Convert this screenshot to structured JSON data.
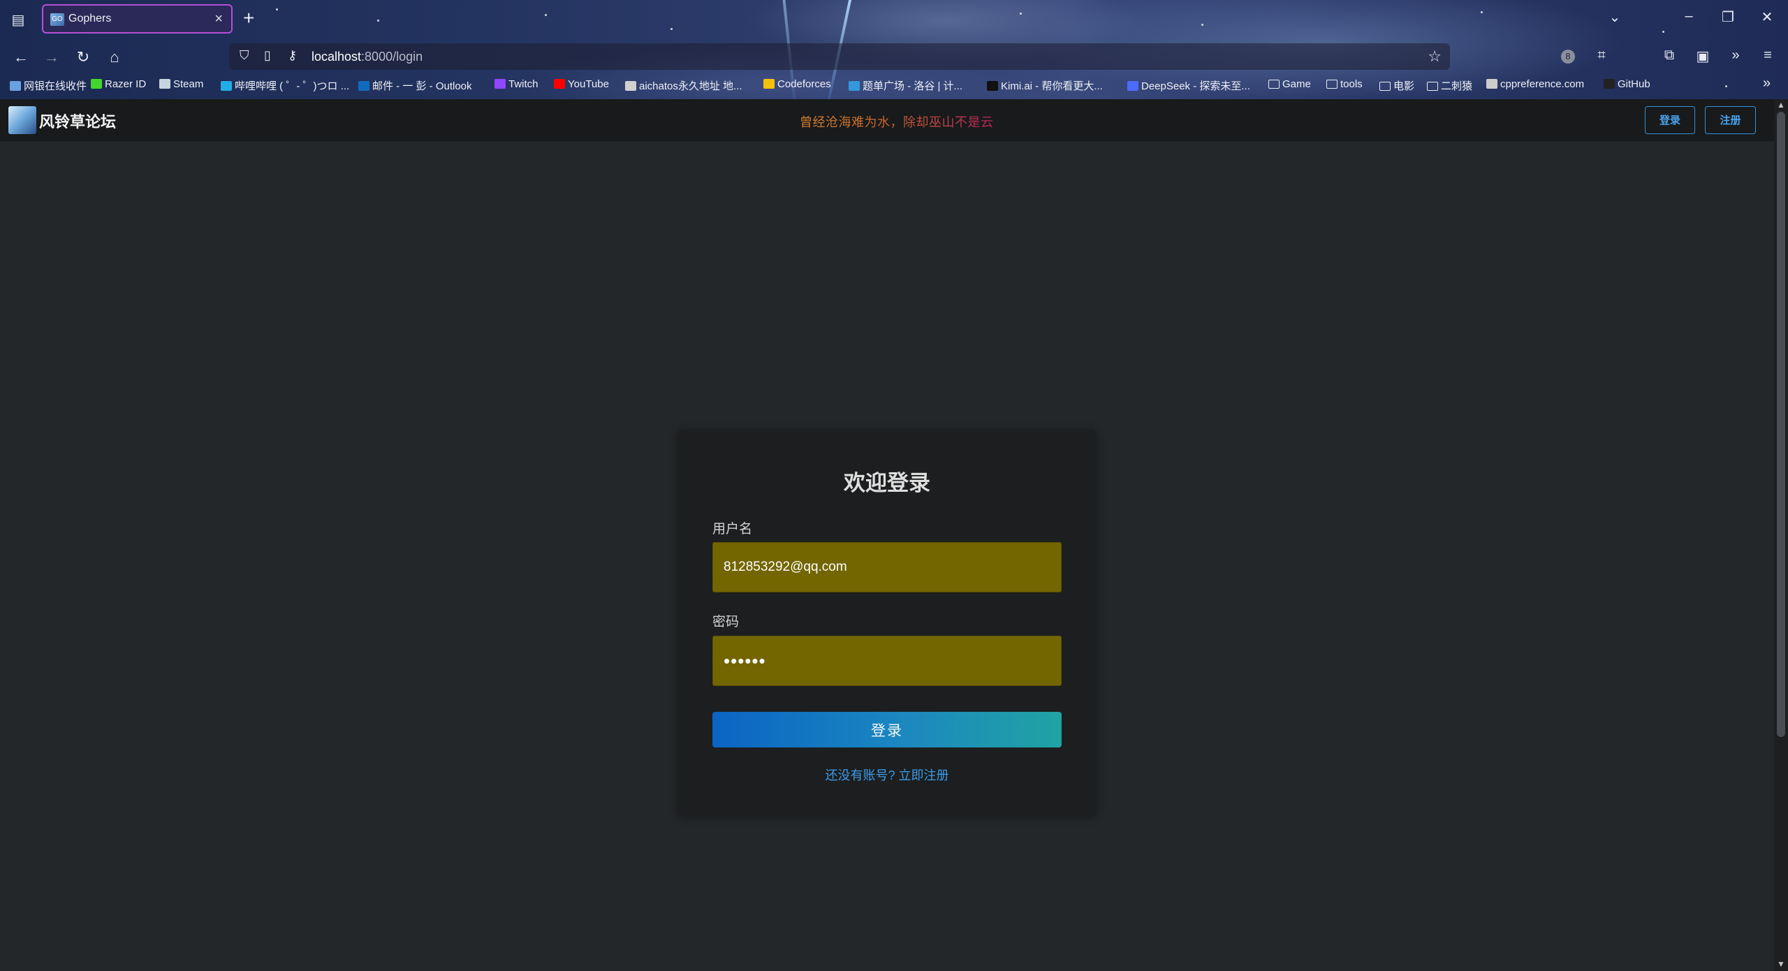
{
  "browser": {
    "tab_title": "Gophers",
    "tab_favicon_text": "GO",
    "url_host": "localhost",
    "url_path": ":8000/login",
    "extension_badge": "8",
    "bookmarks": [
      {
        "label": "网银在线收件",
        "color": "#6aa0e0"
      },
      {
        "label": "Razer ID",
        "color": "#44d62c"
      },
      {
        "label": "Steam",
        "color": "#c7d5e0"
      },
      {
        "label": "哔哩哔哩 ( ゜- ゜)つロ ...",
        "color": "#23ade5"
      },
      {
        "label": "邮件 - 一 彭 - Outlook",
        "color": "#0f6cbd"
      },
      {
        "label": "Twitch",
        "color": "#9146ff"
      },
      {
        "label": "YouTube",
        "color": "#ff0000"
      },
      {
        "label": "aichatos永久地址 地...",
        "color": "#d0d0d0"
      },
      {
        "label": "Codeforces",
        "color": "#f4c20d"
      },
      {
        "label": "题单广场 - 洛谷 | 计...",
        "color": "#3498db"
      },
      {
        "label": "Kimi.ai - 帮你看更大...",
        "color": "#111111"
      },
      {
        "label": "DeepSeek - 探索未至...",
        "color": "#4d6bfe"
      },
      {
        "label": "Game",
        "color": "folder"
      },
      {
        "label": "tools",
        "color": "folder"
      },
      {
        "label": "电影",
        "color": "folder"
      },
      {
        "label": "二刺猿",
        "color": "folder"
      },
      {
        "label": "cppreference.com",
        "color": "#cccccc"
      },
      {
        "label": "GitHub",
        "color": "#222222"
      }
    ]
  },
  "site": {
    "logo_text": "风铃草论坛",
    "motto": "曾经沧海难为水，除却巫山不是云",
    "login_label": "登录",
    "register_label": "注册"
  },
  "login_form": {
    "title": "欢迎登录",
    "username_label": "用户名",
    "username_value": "812853292@qq.com",
    "password_label": "密码",
    "password_value": "••••••",
    "submit_label": "登录",
    "register_prompt": "还没有账号? 立即注册"
  },
  "colors": {
    "accent": "#3a8fd6",
    "autofill_bg": "#736500",
    "page_bg": "#24272a",
    "card_bg": "#1c1e1f"
  }
}
